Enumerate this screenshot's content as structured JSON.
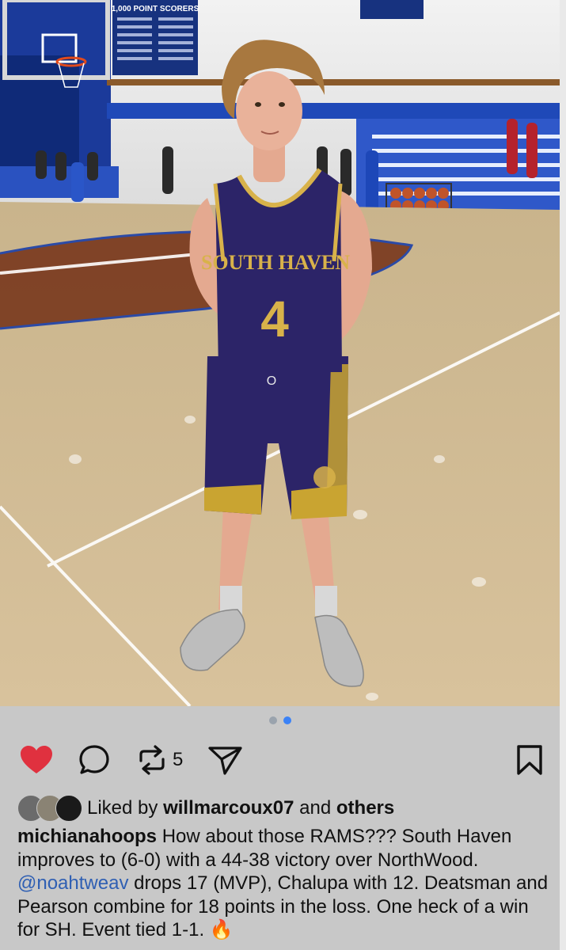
{
  "photo": {
    "jersey_team": "SOUTH HAVEN",
    "jersey_number": "4",
    "banner_text": "1,000 POINT SCORERS",
    "shorts_logo": "O"
  },
  "pager": {
    "total": 2,
    "active": 2
  },
  "actions": {
    "like_icon": "heart-filled-icon",
    "comment_icon": "comment-icon",
    "repost_icon": "repost-icon",
    "repost_count": "5",
    "share_icon": "send-icon",
    "save_icon": "bookmark-icon",
    "like_color": "#e0313f"
  },
  "likes": {
    "prefix": "Liked by",
    "user": "willmarcoux07",
    "and": "and",
    "others": "others"
  },
  "caption": {
    "username": "michianahoops",
    "text_1": "How about those RAMS??? South Haven improves to (6-0) with a 44-38 victory over NorthWood.",
    "mention": "@noahtweav",
    "text_2": "drops 17 (MVP), Chalupa with 12. Deatsman and Pearson combine for 18 points in the loss. One heck of a win for SH. Event tied 1-1.",
    "emoji": "🔥"
  }
}
